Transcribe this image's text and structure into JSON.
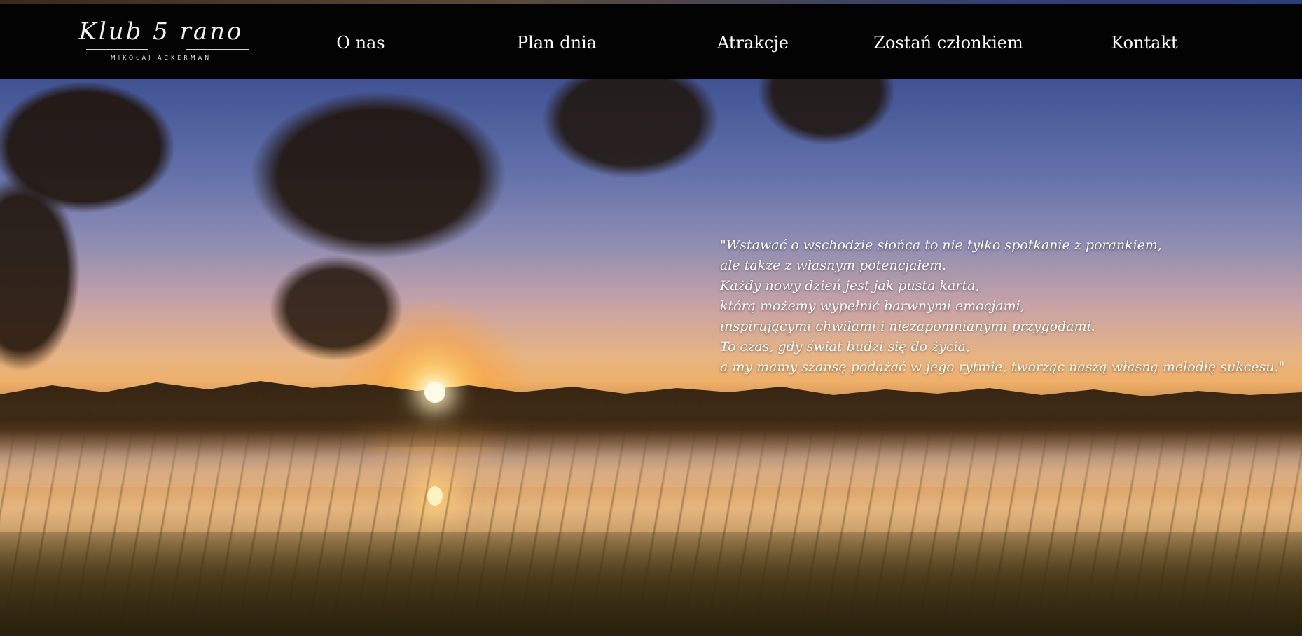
{
  "brand": {
    "logo_script": "Klub 5 rano",
    "logo_subtitle": "MIKOŁAJ ACKERMAN"
  },
  "nav": {
    "items": [
      {
        "label": "O nas"
      },
      {
        "label": "Plan dnia"
      },
      {
        "label": "Atrakcje"
      },
      {
        "label": "Zostań członkiem"
      },
      {
        "label": "Kontakt"
      }
    ]
  },
  "hero": {
    "quote_lines": [
      "\"Wstawać o wschodzie słońca to nie tylko spotkanie z porankiem,",
      "ale także z własnym potencjałem.",
      "Każdy nowy dzień jest jak pusta karta,",
      "którą możemy wypełnić barwnymi emocjami,",
      "inspirującymi chwilami i niezapomnianymi przygodami.",
      "To czas, gdy świat budzi się do życia,",
      "a my mamy szansę podążać w jego rytmie, tworząc naszą własną melodię sukcesu.\""
    ]
  },
  "colors": {
    "navbar_bg": "#030303",
    "nav_text": "#ffffff",
    "sky_top": "#2c3e78",
    "sun": "#fffbe6"
  }
}
